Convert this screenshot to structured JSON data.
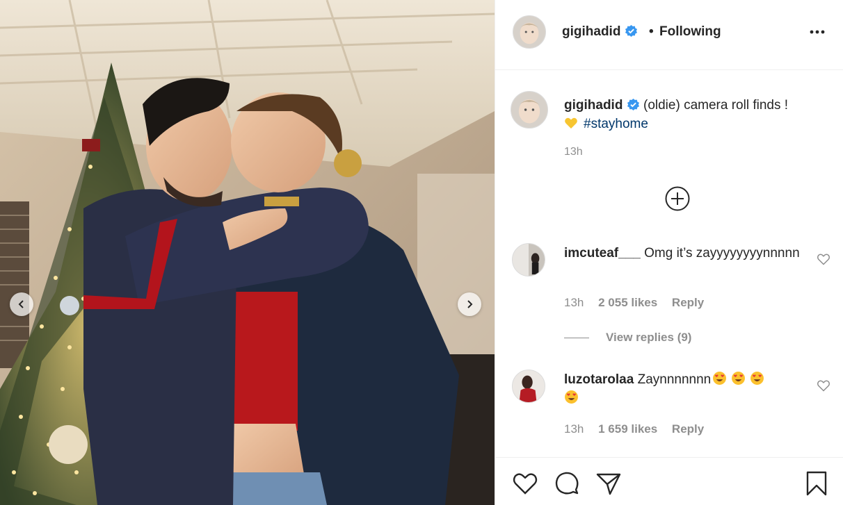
{
  "post": {
    "username": "gigihadid",
    "follow_status": "Following",
    "dot": "•"
  },
  "caption": {
    "username": "gigihadid",
    "text": "(oldie) camera roll finds !",
    "hashtag": "#stayhome",
    "time": "13h"
  },
  "comments": [
    {
      "username": "imcuteaf___",
      "text": "Omg it’s zayyyyyyyynnnnn",
      "time": "13h",
      "likes": "2 055 likes",
      "reply_label": "Reply",
      "view_replies": "View replies (9)"
    },
    {
      "username": "luzotarolaa",
      "text": "Zaynnnnnnn",
      "time": "13h",
      "likes": "1 659 likes",
      "reply_label": "Reply"
    }
  ],
  "icons": {
    "verified": "verified-badge-icon",
    "more": "more-options-icon",
    "load_more": "plus-circle-icon",
    "like": "heart-icon",
    "comment": "comment-icon",
    "share": "share-icon",
    "save": "bookmark-icon",
    "carousel_prev": "chevron-left-icon",
    "carousel_next": "chevron-right-icon"
  },
  "colors": {
    "verified_blue": "#3897f0",
    "hashtag": "#00376b",
    "secondary_text": "#8e8e8e",
    "primary_text": "#262626",
    "divider": "#efefef"
  }
}
